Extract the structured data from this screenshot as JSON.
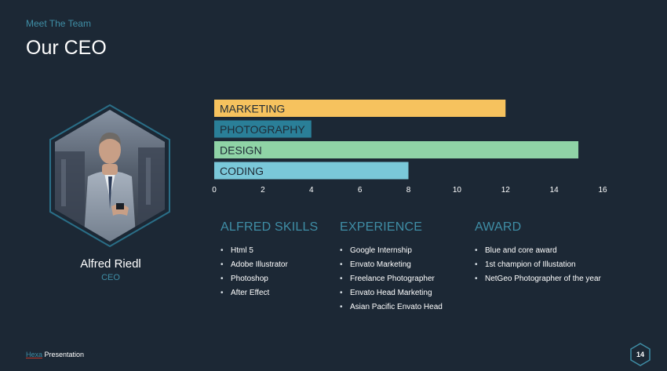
{
  "slide": {
    "eyebrow": "Meet The Team",
    "title": "Our CEO"
  },
  "person": {
    "name": "Alfred Riedl",
    "role": "CEO"
  },
  "chart_data": {
    "type": "bar",
    "orientation": "horizontal",
    "categories": [
      "MARKETING",
      "PHOTOGRAPHY",
      "DESIGN",
      "CODING"
    ],
    "values": [
      12,
      4,
      15,
      8
    ],
    "colors": [
      "#f6c25e",
      "#2a7f98",
      "#8fd3a6",
      "#7ac8d9"
    ],
    "xlim": [
      0,
      16
    ],
    "xticks": [
      0,
      2,
      4,
      6,
      8,
      10,
      12,
      14,
      16
    ],
    "grid": false,
    "title": "",
    "xlabel": "",
    "ylabel": ""
  },
  "columns": {
    "skills": {
      "heading": "ALFRED SKILLS",
      "items": [
        "Html 5",
        "Adobe Illustrator",
        "Photoshop",
        "After Effect"
      ]
    },
    "experience": {
      "heading": "EXPERIENCE",
      "items": [
        "Google Internship",
        "Envato Marketing",
        "Freelance Photographer",
        "Envato Head Marketing",
        "Asian Pacific Envato Head"
      ]
    },
    "award": {
      "heading": "AWARD",
      "items": [
        "Blue and core award",
        "1st champion of Illustation",
        "NetGeo Photographer of the year"
      ]
    }
  },
  "footer": {
    "brand": "Hexa",
    "text": " Presentation"
  },
  "page_number": "14",
  "colors": {
    "background": "#1c2835",
    "accent": "#3f8ea6",
    "hex_border": "#2a6e87"
  },
  "icons": {
    "bullet": "bullet-icon",
    "page_badge": "hexagon-badge-icon"
  }
}
